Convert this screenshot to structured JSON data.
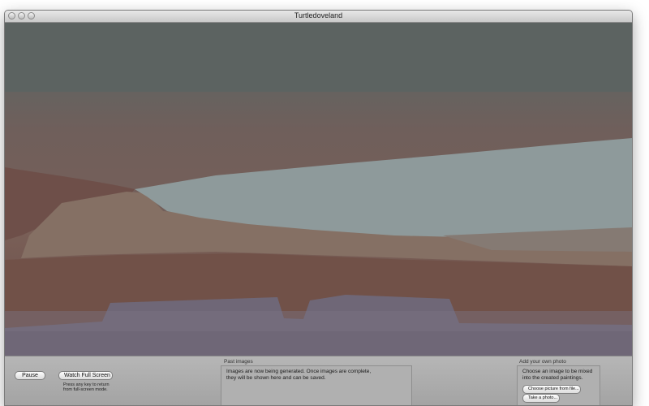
{
  "window": {
    "title": "Turtledoveland"
  },
  "controls": {
    "pause_label": "Pause",
    "fullscreen_label": "Watch Full Screen",
    "fullscreen_hint_line1": "Press any key to return",
    "fullscreen_hint_line2": "from full-screen mode."
  },
  "past_images": {
    "heading": "Past images",
    "message_line1": "Images are now being generated. Once images are complete,",
    "message_line2": "they will be shown here and can be saved."
  },
  "own_photo": {
    "heading": "Add your own photo",
    "message_line1": "Choose an image to be mixed",
    "message_line2": "into the created paintings.",
    "choose_file_label": "Choose picture from file...",
    "take_photo_label": "Take a photo..."
  }
}
